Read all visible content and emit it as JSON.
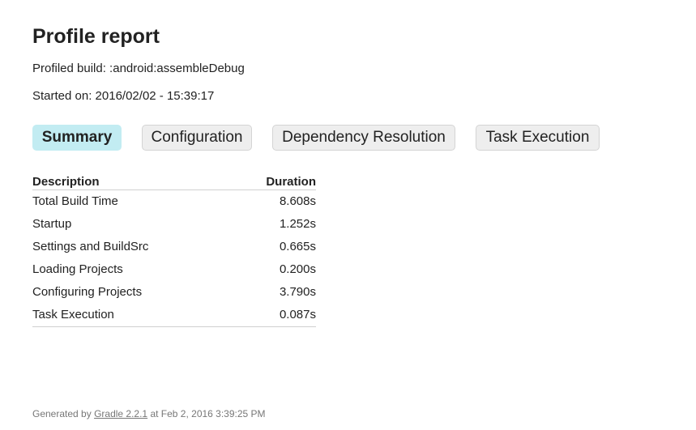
{
  "header": {
    "title": "Profile report",
    "profiled_build": "Profiled build: :android:assembleDebug",
    "started_on": "Started on: 2016/02/02 - 15:39:17"
  },
  "tabs": [
    {
      "label": "Summary",
      "active": true
    },
    {
      "label": "Configuration",
      "active": false
    },
    {
      "label": "Dependency Resolution",
      "active": false
    },
    {
      "label": "Task Execution",
      "active": false
    }
  ],
  "summary_table": {
    "columns": [
      "Description",
      "Duration"
    ],
    "rows": [
      {
        "description": "Total Build Time",
        "duration": "8.608s"
      },
      {
        "description": "Startup",
        "duration": "1.252s"
      },
      {
        "description": "Settings and BuildSrc",
        "duration": "0.665s"
      },
      {
        "description": "Loading Projects",
        "duration": "0.200s"
      },
      {
        "description": "Configuring Projects",
        "duration": "3.790s"
      },
      {
        "description": "Task Execution",
        "duration": "0.087s"
      }
    ]
  },
  "footer": {
    "prefix": "Generated by ",
    "link_text": "Gradle 2.2.1",
    "suffix": " at Feb 2, 2016 3:39:25 PM"
  },
  "colors": {
    "active_tab": "#c2ecf2",
    "inactive_tab": "#eeeeee",
    "footer_text": "#777777"
  }
}
